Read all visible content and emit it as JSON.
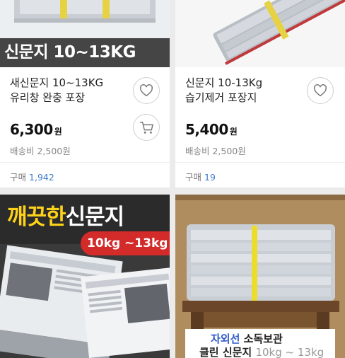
{
  "products": [
    {
      "banner": "신문지 10~13KG",
      "title_lines": [
        "새신문지 10~13KG",
        "유리창 완충 포장"
      ],
      "price": "6,300",
      "currency": "원",
      "shipping": "배송비 2,500원",
      "buy_label": "구매",
      "buy_count": "1,942"
    },
    {
      "title_lines": [
        "신문지 10-13Kg",
        "습기제거 포장지"
      ],
      "price": "5,400",
      "currency": "원",
      "shipping": "배송비 2,500원",
      "buy_label": "구매",
      "buy_count": "19"
    },
    {
      "headline_highlight": "깨끗한",
      "headline_rest": "신문지",
      "pill": "10kg ~13kg"
    },
    {
      "caption_blue": "자외선",
      "caption_rest": " 소독보관",
      "caption_line2": "클린 신문지 ",
      "caption_line2_gray": "10kg ~ 13kg"
    }
  ],
  "icons": {
    "wishlist": "heart-icon",
    "cart": "cart-icon"
  },
  "colors": {
    "accent_blue": "#3d7bc9",
    "pill_red": "#d32a2a",
    "highlight_yellow": "#ffd21a"
  }
}
